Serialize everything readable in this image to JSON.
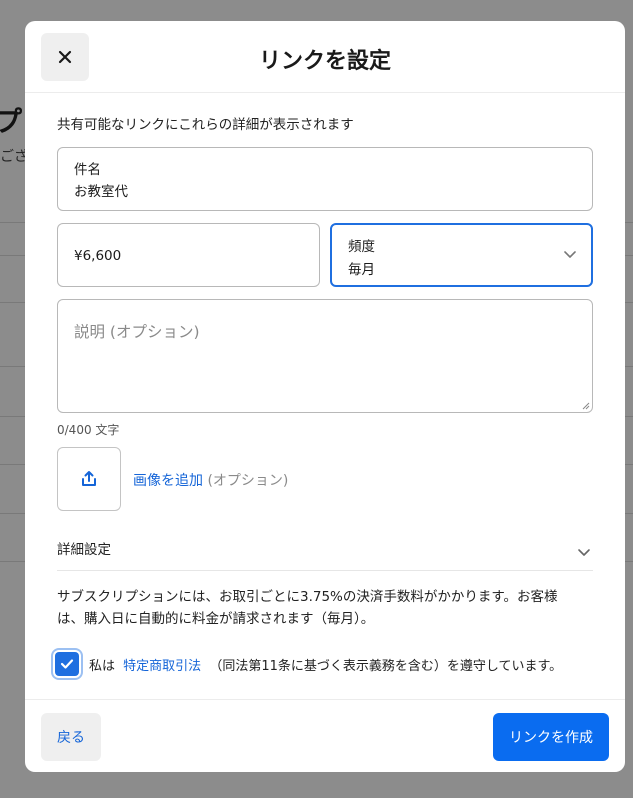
{
  "background": {
    "title_fragment": "プ",
    "subtitle_fragment": "ござ"
  },
  "modal": {
    "title": "リンクを設定",
    "close_icon": "close-icon",
    "intro": "共有可能なリンクにこれらの詳細が表示されます"
  },
  "form": {
    "subject": {
      "label": "件名",
      "value": "お教室代"
    },
    "amount": {
      "value": "¥6,600"
    },
    "frequency": {
      "label": "頻度",
      "value": "毎月",
      "icon": "chevron-down-icon"
    },
    "description": {
      "placeholder": "説明 (オプション)"
    },
    "char_count": "0/400 文字",
    "image": {
      "icon": "upload-icon",
      "link": "画像を追加",
      "optional": "(オプション)"
    },
    "advanced": {
      "label": "詳細設定",
      "icon": "chevron-down-icon"
    }
  },
  "notice": "サブスクリプションには、お取引ごとに3.75%の決済手数料がかかります。お客様は、購入日に自動的に料金が請求されます（毎月）。",
  "consent": {
    "checked": true,
    "prefix": "私は",
    "link": "特定商取引法",
    "suffix": "（同法第11条に基づく表示義務を含む）を遵守しています。"
  },
  "footer": {
    "back_label": "戻る",
    "create_label": "リンクを作成"
  },
  "colors": {
    "accent": "#0a6cf0",
    "link": "#1565d8",
    "focus_border": "#1f6fe0"
  }
}
